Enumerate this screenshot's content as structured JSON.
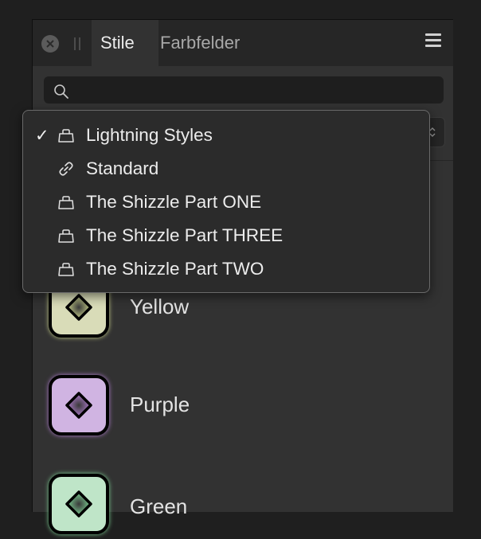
{
  "tabs": {
    "active_label": "Stile",
    "inactive_label": "Farbfelder"
  },
  "icons": {
    "close": "close-icon",
    "grip": "grip-handle-icon",
    "menu": "hamburger-menu-icon",
    "search": "search-icon",
    "category": "category-bag-icon",
    "link": "link-icon"
  },
  "search": {
    "value": "",
    "placeholder": ""
  },
  "dropdown": {
    "items": [
      {
        "label": "Lightning Styles",
        "checked": true,
        "icon": "category-bag-icon"
      },
      {
        "label": "Standard",
        "checked": false,
        "icon": "link-icon"
      },
      {
        "label": "The Shizzle Part ONE",
        "checked": false,
        "icon": "category-bag-icon"
      },
      {
        "label": "The Shizzle Part THREE",
        "checked": false,
        "icon": "category-bag-icon"
      },
      {
        "label": "The Shizzle Part TWO",
        "checked": false,
        "icon": "category-bag-icon"
      }
    ],
    "check_glyph": "✓"
  },
  "styles": [
    {
      "name": "Yellow",
      "color": "#d9dcb8",
      "glow": "#c8d08a"
    },
    {
      "name": "Purple",
      "color": "#d0b4e2",
      "glow": "#b07ccf"
    },
    {
      "name": "Green",
      "color": "#bfe5c8",
      "glow": "#7ccf93"
    }
  ]
}
